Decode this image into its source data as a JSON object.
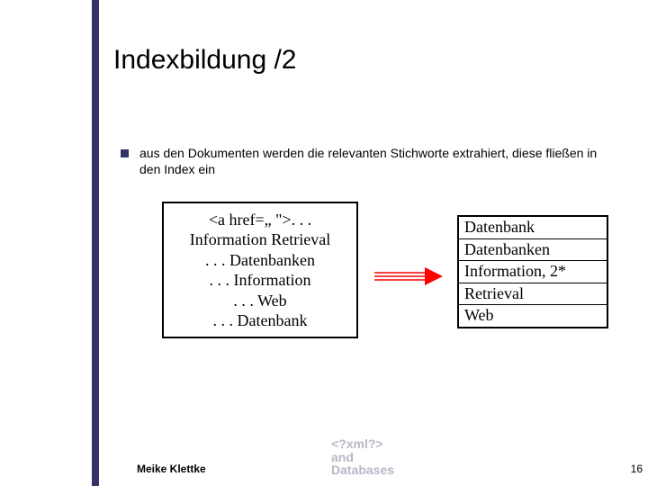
{
  "title": "Indexbildung /2",
  "bullet": "aus den Dokumenten werden die relevanten Stichworte extrahiert, diese fließen in den Index ein",
  "doc_lines": [
    "<a href=„ \">. . .",
    "Information Retrieval",
    ". . . Datenbanken",
    ". . . Information",
    ". . . Web",
    ". . . Datenbank"
  ],
  "index_rows": [
    "Datenbank",
    "Datenbanken",
    "Information, 2*",
    "Retrieval",
    "Web"
  ],
  "footer": {
    "author": "Meike Klettke",
    "logo_line1": "<?xml?>",
    "logo_line2": "and",
    "logo_line3": "Databases",
    "page": "16"
  },
  "colors": {
    "accent": "#333366",
    "arrow": "#ff0000"
  }
}
